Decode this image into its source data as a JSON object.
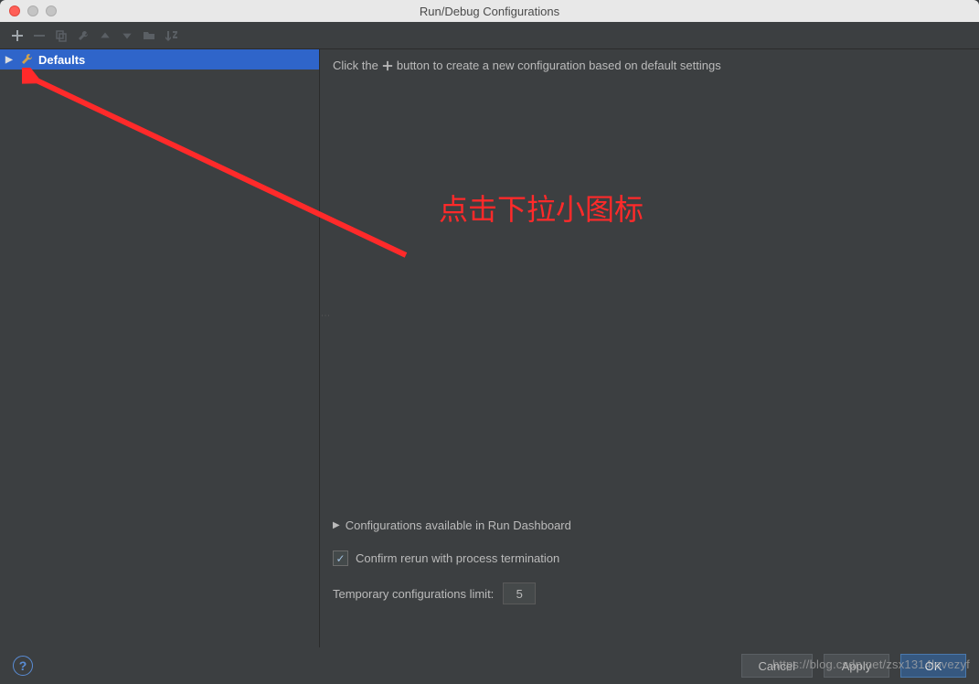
{
  "window": {
    "title": "Run/Debug Configurations"
  },
  "tree": {
    "defaults_label": "Defaults"
  },
  "hint": {
    "pre": "Click the",
    "post": "button to create a new configuration based on default settings"
  },
  "dashboard": {
    "label": "Configurations available in Run Dashboard"
  },
  "confirm_rerun": {
    "label": "Confirm rerun with process termination",
    "checked": true
  },
  "temp_limit": {
    "label": "Temporary configurations limit:",
    "value": "5"
  },
  "buttons": {
    "cancel": "Cancel",
    "apply": "Apply",
    "ok": "OK"
  },
  "annotation": {
    "text": "点击下拉小图标"
  },
  "watermark": "https://blog.csdn.net/zsx1314lovezyf"
}
